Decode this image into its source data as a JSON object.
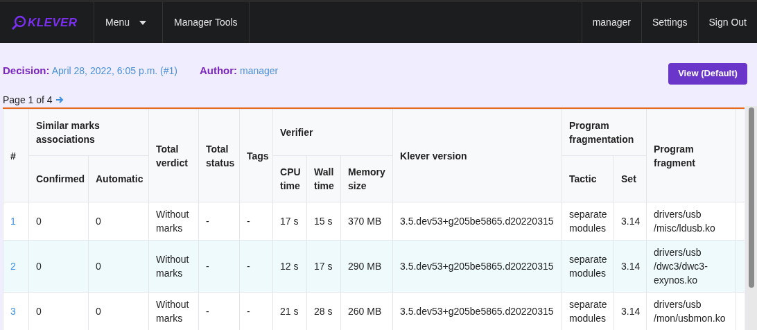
{
  "navbar": {
    "logo": "KLEVER",
    "items": [
      {
        "label": "Menu",
        "kind": "dropdown"
      },
      {
        "label": "Manager Tools",
        "kind": "link"
      }
    ],
    "right_items": [
      "manager",
      "Settings",
      "Sign Out"
    ]
  },
  "decision": {
    "label": "Decision:",
    "value": "April 28, 2022, 6:05 p.m. (#1)"
  },
  "author": {
    "label": "Author:",
    "value": "manager"
  },
  "view_button": "View (Default)",
  "pagination": "Page 1 of 4",
  "table": {
    "header_groups": [
      {
        "label": "#"
      },
      {
        "label": "Similar marks associations",
        "children": [
          "Confirmed",
          "Automatic"
        ]
      },
      {
        "label": "Total verdict"
      },
      {
        "label": "Total status"
      },
      {
        "label": "Tags"
      },
      {
        "label": "Verifier",
        "children": [
          "CPU time",
          "Wall time",
          "Memory size"
        ]
      },
      {
        "label": "Klever version"
      },
      {
        "label": "Program fragmentation",
        "children": [
          "Tactic",
          "Set"
        ]
      },
      {
        "label": "Program fragment"
      }
    ],
    "rows": [
      {
        "cells": [
          "1",
          "0",
          "0",
          "Without marks",
          "-",
          "-",
          "17 s",
          "15 s",
          "370 MB",
          "3.5.dev53+g205be5865.d20220315",
          "separate modules",
          "3.14",
          "drivers/usb /misc/ldusb.ko"
        ]
      },
      {
        "cells": [
          "2",
          "0",
          "0",
          "Without marks",
          "-",
          "-",
          "12 s",
          "17 s",
          "290 MB",
          "3.5.dev53+g205be5865.d20220315",
          "separate modules",
          "3.14",
          "drivers/usb /dwc3/dwc3-exynos.ko"
        ]
      },
      {
        "cells": [
          "3",
          "0",
          "0",
          "Without marks",
          "-",
          "-",
          "21 s",
          "28 s",
          "260 MB",
          "3.5.dev53+g205be5865.d20220315",
          "separate modules",
          "3.14",
          "drivers/usb /mon/usbmon.ko"
        ]
      }
    ]
  }
}
